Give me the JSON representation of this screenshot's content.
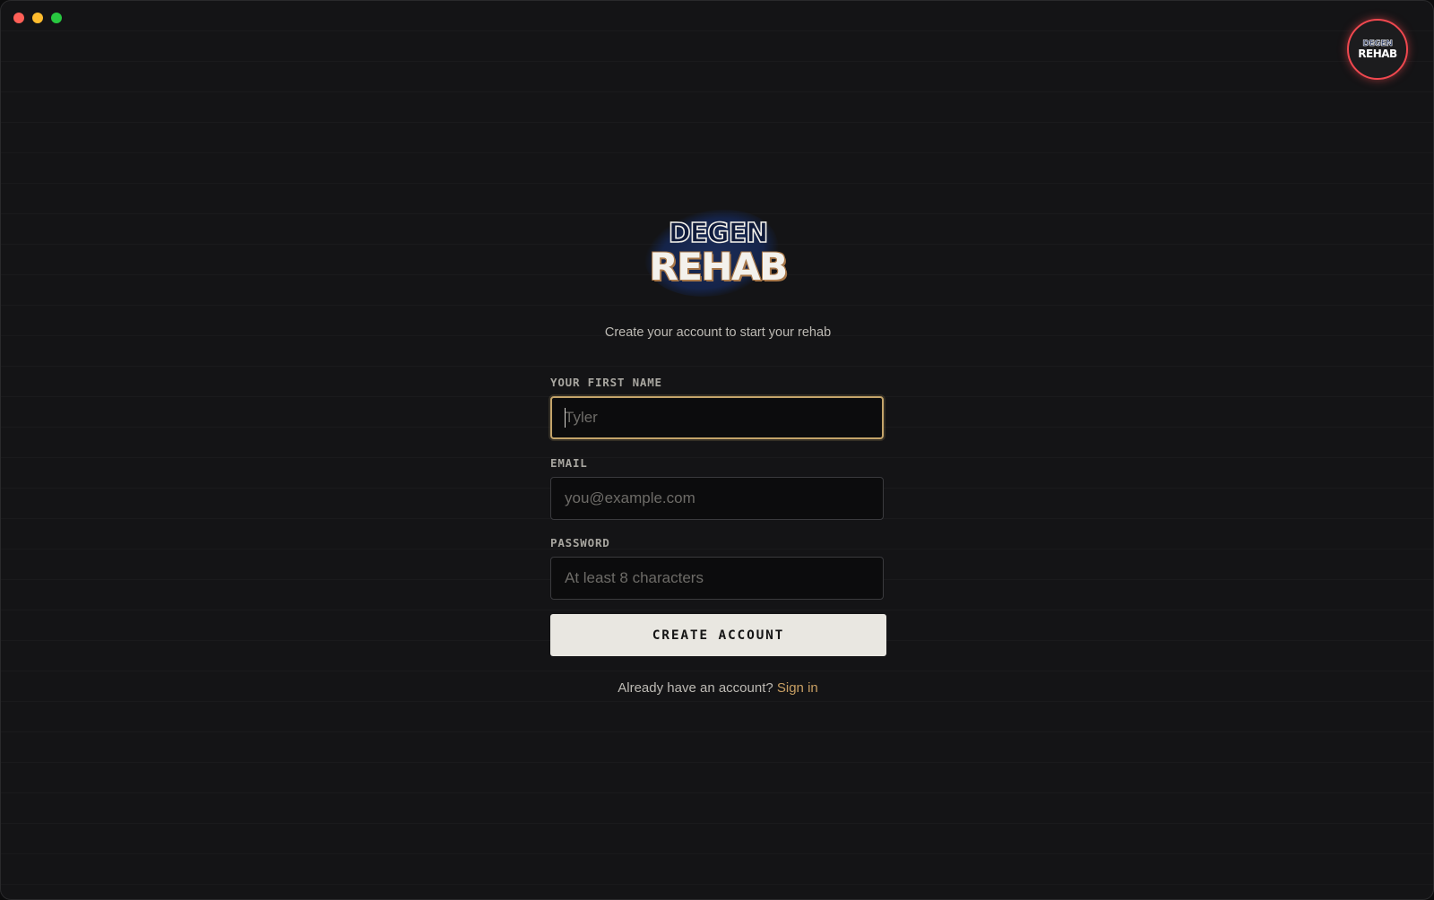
{
  "window": {
    "controls": [
      "close",
      "minimize",
      "maximize"
    ]
  },
  "avatar": {
    "line1": "DEGEN",
    "line2": "REHAB"
  },
  "logo": {
    "line1": "DEGEN",
    "line2": "REHAB"
  },
  "subtitle": "Create your account to start your rehab",
  "form": {
    "first_name": {
      "label": "YOUR FIRST NAME",
      "placeholder": "Tyler",
      "value": ""
    },
    "email": {
      "label": "EMAIL",
      "placeholder": "you@example.com",
      "value": ""
    },
    "password": {
      "label": "PASSWORD",
      "placeholder": "At least 8 characters",
      "value": ""
    },
    "submit_label": "CREATE ACCOUNT"
  },
  "footer": {
    "prompt": "Already have an account?",
    "link": "Sign in"
  },
  "colors": {
    "background": "#141416",
    "accent_gold": "#c4a46a",
    "avatar_ring": "#f0484f",
    "button_bg": "#e9e7e1",
    "link": "#c89f63"
  }
}
